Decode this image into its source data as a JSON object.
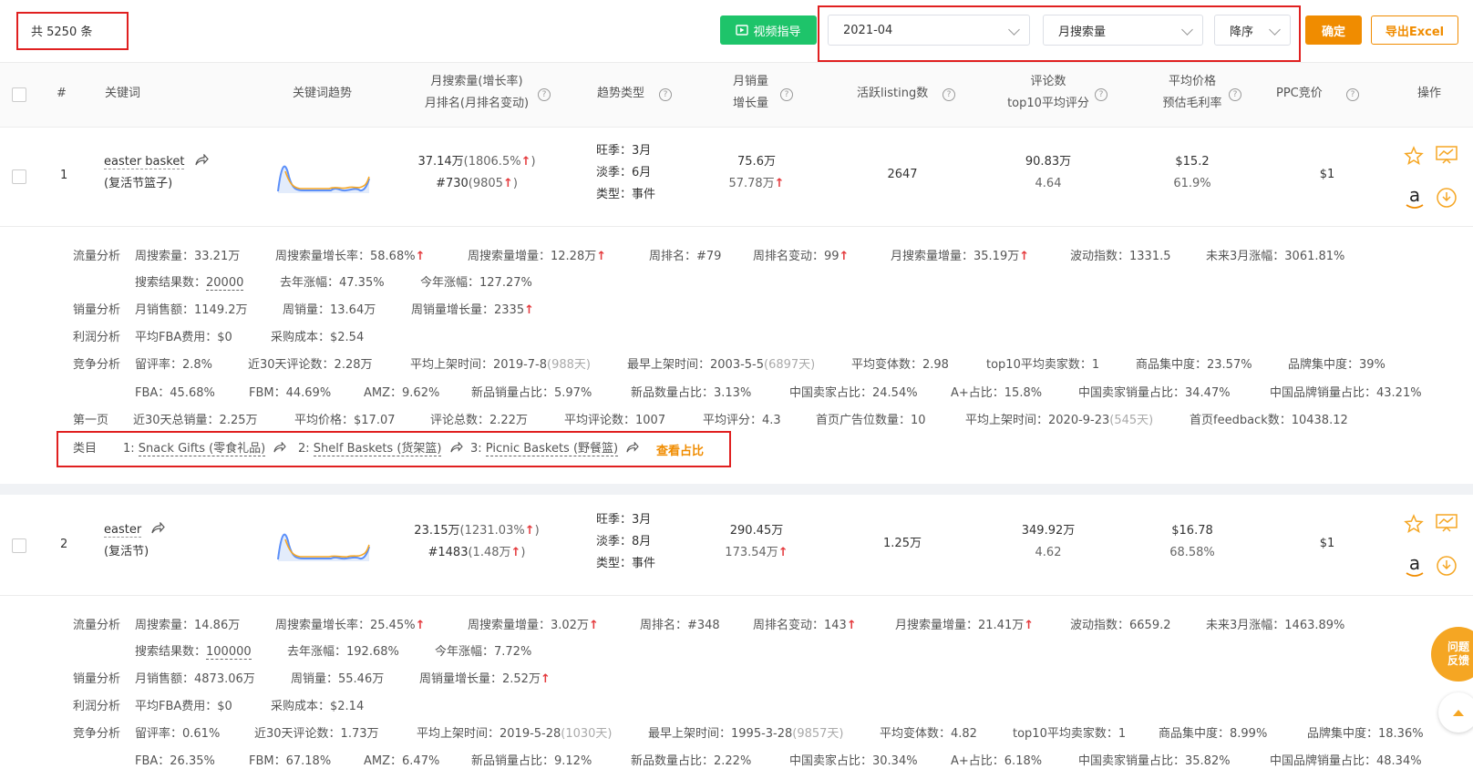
{
  "toolbar": {
    "total": "共 5250 条",
    "video_btn": "视频指导",
    "month": "2021-04",
    "sort_field": "月搜索量",
    "sort_order": "降序",
    "confirm": "确定",
    "export": "导出Excel"
  },
  "header": {
    "index": "#",
    "keyword": "关键词",
    "trend": "关键词趋势",
    "search_1": "月搜索量(增长率)",
    "search_2": "月排名(月排名变动)",
    "trend_type": "趋势类型",
    "sales_1": "月销量",
    "sales_2": "增长量",
    "listing": "活跃listing数",
    "review_1": "评论数",
    "review_2": "top10平均评分",
    "price_1": "平均价格",
    "price_2": "预估毛利率",
    "ppc": "PPC竞价",
    "action": "操作"
  },
  "rows": [
    {
      "index": "1",
      "keyword": "easter basket",
      "keyword_cn": "(复活节篮子)",
      "search": "37.14万",
      "search_rate": "(1806.5%",
      "rank": "#730",
      "rank_change": "(9805",
      "peak": "旺季：3月",
      "low": "淡季：6月",
      "type": "类型：事件",
      "sales": "75.6万",
      "sales_growth": "57.78万",
      "listing": "2647",
      "reviews": "90.83万",
      "rating": "4.64",
      "price": "$15.2",
      "margin": "61.9%",
      "ppc": "$1",
      "traffic_label": "流量分析",
      "t1": "周搜索量：33.21万",
      "t2": "周搜索量增长率：58.68%",
      "t3": "周搜索量增量：12.28万",
      "t4": "周排名：#79",
      "t5": "周排名变动：99",
      "t6": "月搜索量增量：35.19万",
      "t7": "波动指数：1331.5",
      "t8": "未来3月涨幅：3061.81%",
      "t9": "搜索结果数：",
      "t9v": "20000",
      "t10": "去年涨幅：47.35%",
      "t11": "今年涨幅：127.27%",
      "sales_label": "销量分析",
      "s1": "月销售额：1149.2万",
      "s2": "周销量：13.64万",
      "s3": "周销量增长量：2335",
      "profit_label": "利润分析",
      "p1": "平均FBA费用：$0",
      "p2": "采购成本：$2.54",
      "comp_label": "竞争分析",
      "c1": "留评率：2.8%",
      "c2": "近30天评论数：2.28万",
      "c3": "平均上架时间：2019-7-8",
      "c3d": "(988天)",
      "c4": "最早上架时间：2003-5-5",
      "c4d": "(6897天)",
      "c5": "平均变体数：2.98",
      "c6": "top10平均卖家数：1",
      "c7": "商品集中度：23.57%",
      "c8": "品牌集中度：39%",
      "c9": "FBA：45.68%",
      "c10": "FBM：44.69%",
      "c11": "AMZ：9.62%",
      "c12": "新品销量占比：5.97%",
      "c13": "新品数量占比：3.13%",
      "c14": "中国卖家占比：24.54%",
      "c15": "A+占比：15.8%",
      "c16": "中国卖家销量占比：34.47%",
      "c17": "中国品牌销量占比：43.21%",
      "page_label": "第一页",
      "f1": "近30天总销量：2.25万",
      "f2": "平均价格：$17.07",
      "f3": "评论总数：2.22万",
      "f4": "平均评论数：1007",
      "f5": "平均评分：4.3",
      "f6": "首页广告位数量：10",
      "f7": "平均上架时间：2020-9-23",
      "f7d": "(545天)",
      "f8": "首页feedback数：10438.12",
      "cat_label": "类目",
      "cat1n": "1:",
      "cat1": "Snack Gifts (零食礼品)",
      "cat2n": "2:",
      "cat2": "Shelf Baskets (货架篮)",
      "cat3n": "3:",
      "cat3": "Picnic Baskets (野餐篮)",
      "cat_view": "查看占比"
    },
    {
      "index": "2",
      "keyword": "easter",
      "keyword_cn": "(复活节)",
      "search": "23.15万",
      "search_rate": "(1231.03%",
      "rank": "#1483",
      "rank_change": "(1.48万",
      "peak": "旺季：3月",
      "low": "淡季：8月",
      "type": "类型：事件",
      "sales": "290.45万",
      "sales_growth": "173.54万",
      "listing": "1.25万",
      "reviews": "349.92万",
      "rating": "4.62",
      "price": "$16.78",
      "margin": "68.58%",
      "ppc": "$1",
      "traffic_label": "流量分析",
      "t1": "周搜索量：14.86万",
      "t2": "周搜索量增长率：25.45%",
      "t3": "周搜索量增量：3.02万",
      "t4": "周排名：#348",
      "t5": "周排名变动：143",
      "t6": "月搜索量增量：21.41万",
      "t7": "波动指数：6659.2",
      "t8": "未来3月涨幅：1463.89%",
      "t9": "搜索结果数：",
      "t9v": "100000",
      "t10": "去年涨幅：192.68%",
      "t11": "今年涨幅：7.72%",
      "sales_label": "销量分析",
      "s1": "月销售额：4873.06万",
      "s2": "周销量：55.46万",
      "s3": "周销量增长量：2.52万",
      "profit_label": "利润分析",
      "p1": "平均FBA费用：$0",
      "p2": "采购成本：$2.14",
      "comp_label": "竞争分析",
      "c1": "留评率：0.61%",
      "c2": "近30天评论数：1.73万",
      "c3": "平均上架时间：2019-5-28",
      "c3d": "(1030天)",
      "c4": "最早上架时间：1995-3-28",
      "c4d": "(9857天)",
      "c5": "平均变体数：4.82",
      "c6": "top10平均卖家数：1",
      "c7": "商品集中度：8.99%",
      "c8": "品牌集中度：18.36%",
      "c9": "FBA：26.35%",
      "c10": "FBM：67.18%",
      "c11": "AMZ：6.47%",
      "c12": "新品销量占比：9.12%",
      "c13": "新品数量占比：2.22%",
      "c14": "中国卖家占比：30.34%",
      "c15": "A+占比：6.18%",
      "c16": "中国卖家销量占比：35.82%",
      "c17": "中国品牌销量占比：48.34%"
    }
  ],
  "float": {
    "feedback_1": "问题",
    "feedback_2": "反馈"
  },
  "up_arrow": "↑",
  "colors": {
    "green": "#1ec46a",
    "orange": "#f08c00",
    "red_box": "#e02020",
    "up": "#e4393c"
  }
}
